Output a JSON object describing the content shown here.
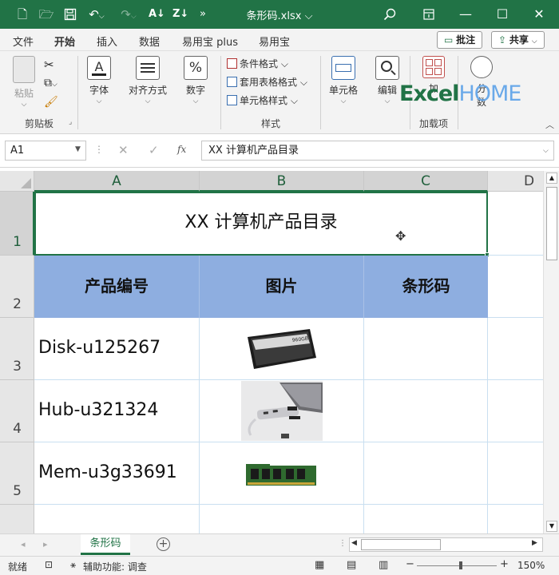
{
  "titlebar": {
    "title": "条形码.xlsx ⌵",
    "save_icon": "save-icon",
    "undo_icon": "undo-icon"
  },
  "tabs": [
    "文件",
    "开始",
    "插入",
    "数据",
    "易用宝 plus",
    "易用宝"
  ],
  "ribbon_right": {
    "comment": "批注",
    "share": "共享"
  },
  "ribbon": {
    "paste": "粘贴",
    "clipboard": "剪贴板",
    "font": "字体",
    "align": "对齐方式",
    "number": "数字",
    "cond_format": "条件格式 ⌵",
    "table_format": "套用表格格式 ⌵",
    "cell_style": "单元格样式 ⌵",
    "styles": "样式",
    "cells": "单元格",
    "edit": "编辑",
    "addins_btn": "加",
    "addins": "加载项",
    "analyze": "分",
    "analyze2": "数",
    "watermark": "ExcelHOME"
  },
  "formula_bar": {
    "name_box": "A1",
    "fx": "fx",
    "formula": "XX 计算机产品目录"
  },
  "columns": [
    "A",
    "B",
    "C",
    "D"
  ],
  "rows": [
    "1",
    "2",
    "3",
    "4",
    "5"
  ],
  "sheet": {
    "title": "XX 计算机产品目录",
    "headers": [
      "产品编号",
      "图片",
      "条形码"
    ],
    "items": [
      {
        "id": "Disk-u125267",
        "image": "ssd-drive"
      },
      {
        "id": "Hub-u321324",
        "image": "usb-hub"
      },
      {
        "id": "Mem-u3g33691",
        "image": "memory-module"
      }
    ],
    "ssd_label": "960GB"
  },
  "sheet_tabs": {
    "active": "条形码"
  },
  "status": {
    "ready": "就绪",
    "accessibility": "辅助功能: 调查",
    "zoom": "150%"
  },
  "colors": {
    "accent": "#217346",
    "header_fill": "#8EAEE0"
  }
}
